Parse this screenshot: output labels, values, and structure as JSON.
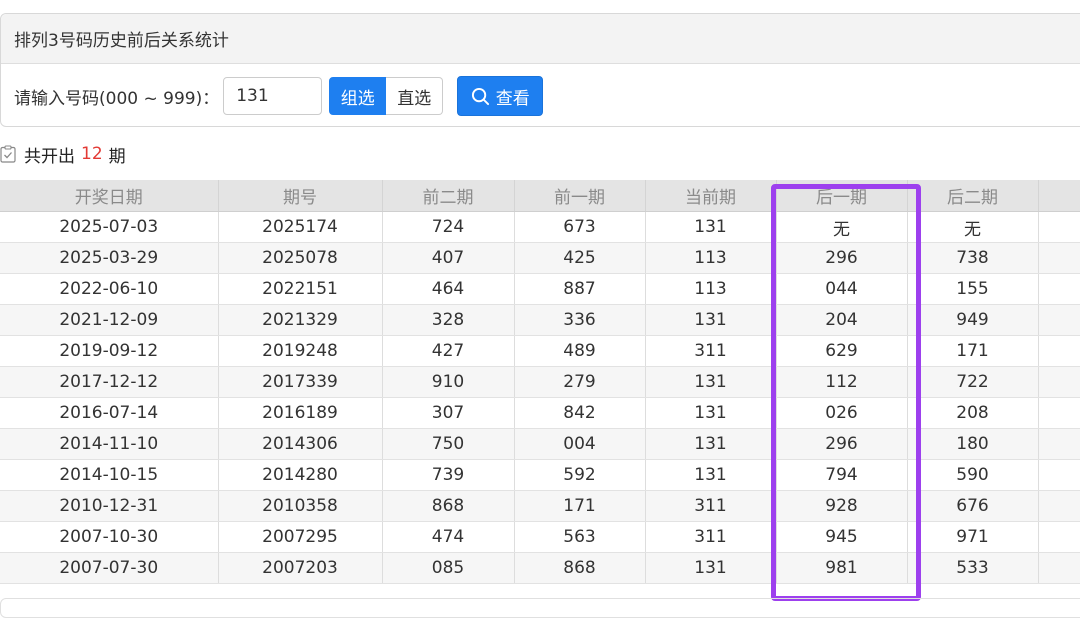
{
  "panel": {
    "title": "排列3号码历史前后关系统计"
  },
  "search": {
    "label": "请输入号码(000 ~ 999)：",
    "value": "131",
    "mode_options": [
      "组选",
      "直选"
    ],
    "active_mode": "组选",
    "view_button_label": "查看",
    "view_button_icon": "search-icon"
  },
  "summary": {
    "prefix": "共开出",
    "count": "12",
    "suffix": "期",
    "icon": "checklist-icon"
  },
  "table": {
    "columns": [
      "开奖日期",
      "期号",
      "前二期",
      "前一期",
      "当前期",
      "后一期",
      "后二期"
    ],
    "rows": [
      [
        "2025-07-03",
        "2025174",
        "724",
        "673",
        "131",
        "无",
        "无"
      ],
      [
        "2025-03-29",
        "2025078",
        "407",
        "425",
        "113",
        "296",
        "738"
      ],
      [
        "2022-06-10",
        "2022151",
        "464",
        "887",
        "113",
        "044",
        "155"
      ],
      [
        "2021-12-09",
        "2021329",
        "328",
        "336",
        "131",
        "204",
        "949"
      ],
      [
        "2019-09-12",
        "2019248",
        "427",
        "489",
        "311",
        "629",
        "171"
      ],
      [
        "2017-12-12",
        "2017339",
        "910",
        "279",
        "131",
        "112",
        "722"
      ],
      [
        "2016-07-14",
        "2016189",
        "307",
        "842",
        "131",
        "026",
        "208"
      ],
      [
        "2014-11-10",
        "2014306",
        "750",
        "004",
        "131",
        "296",
        "180"
      ],
      [
        "2014-10-15",
        "2014280",
        "739",
        "592",
        "131",
        "794",
        "590"
      ],
      [
        "2010-12-31",
        "2010358",
        "868",
        "171",
        "311",
        "928",
        "676"
      ],
      [
        "2007-10-30",
        "2007295",
        "474",
        "563",
        "311",
        "945",
        "971"
      ],
      [
        "2007-07-30",
        "2007203",
        "085",
        "868",
        "131",
        "981",
        "533"
      ]
    ]
  },
  "colors": {
    "primary": "#1e7ff0",
    "count_red": "#e33a35",
    "highlight_purple": "#9d40ee"
  }
}
